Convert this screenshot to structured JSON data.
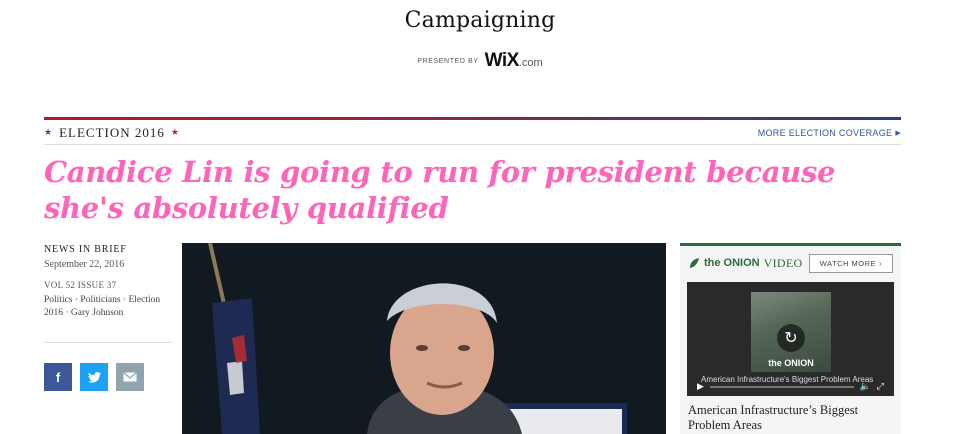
{
  "header": {
    "title": "Campaigning",
    "presented_by": "PRESENTED BY",
    "sponsor_brand": "WiX",
    "sponsor_suffix": ".com"
  },
  "section": {
    "label": "ELECTION 2016",
    "more_link": "MORE ELECTION COVERAGE"
  },
  "article": {
    "headline": "Candice Lin is going to run for president because she's absolutely qualified",
    "kicker": "NEWS IN BRIEF",
    "date": "September 22, 2016",
    "volume": "VOL 52 ISSUE 37",
    "tags": "Politics · Politicians · Election 2016 · Gary Johnson"
  },
  "share": {
    "facebook": "f"
  },
  "sidebar": {
    "brand": "the ONION",
    "brand_suffix": "VIDEO",
    "watch_more": "WATCH MORE",
    "video_overlay_title": "American Infrastructure's Biggest Problem Areas",
    "thumb_brand": "the ONION",
    "caption": "American Infrastructure’s Biggest Problem Areas"
  },
  "colors": {
    "headline": "#ff64b9",
    "link": "#2e5a99",
    "onion_green": "#2e6b3a"
  }
}
